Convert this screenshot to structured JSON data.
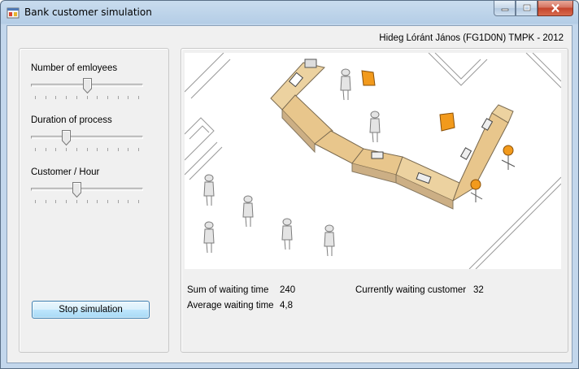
{
  "window": {
    "title": "Bank customer simulation"
  },
  "header": {
    "author": "Hideg Lóránt János (FG1D0N) TMPK - 2012"
  },
  "controls": {
    "employees": {
      "label": "Number of emloyees",
      "value_fraction": 0.5
    },
    "duration": {
      "label": "Duration of process",
      "value_fraction": 0.3
    },
    "customer_rate": {
      "label": "Customer / Hour",
      "value_fraction": 0.4
    },
    "stop_button": "Stop simulation"
  },
  "stats": {
    "sum_waiting_label": "Sum of waiting time",
    "sum_waiting_value": "240",
    "avg_waiting_label": "Average waiting time",
    "avg_waiting_value": "4,8",
    "current_waiting_label": "Currently waiting customer",
    "current_waiting_value": "32"
  },
  "colors": {
    "accent_chair": "#f29a1c",
    "desk": "#e8c68c"
  }
}
